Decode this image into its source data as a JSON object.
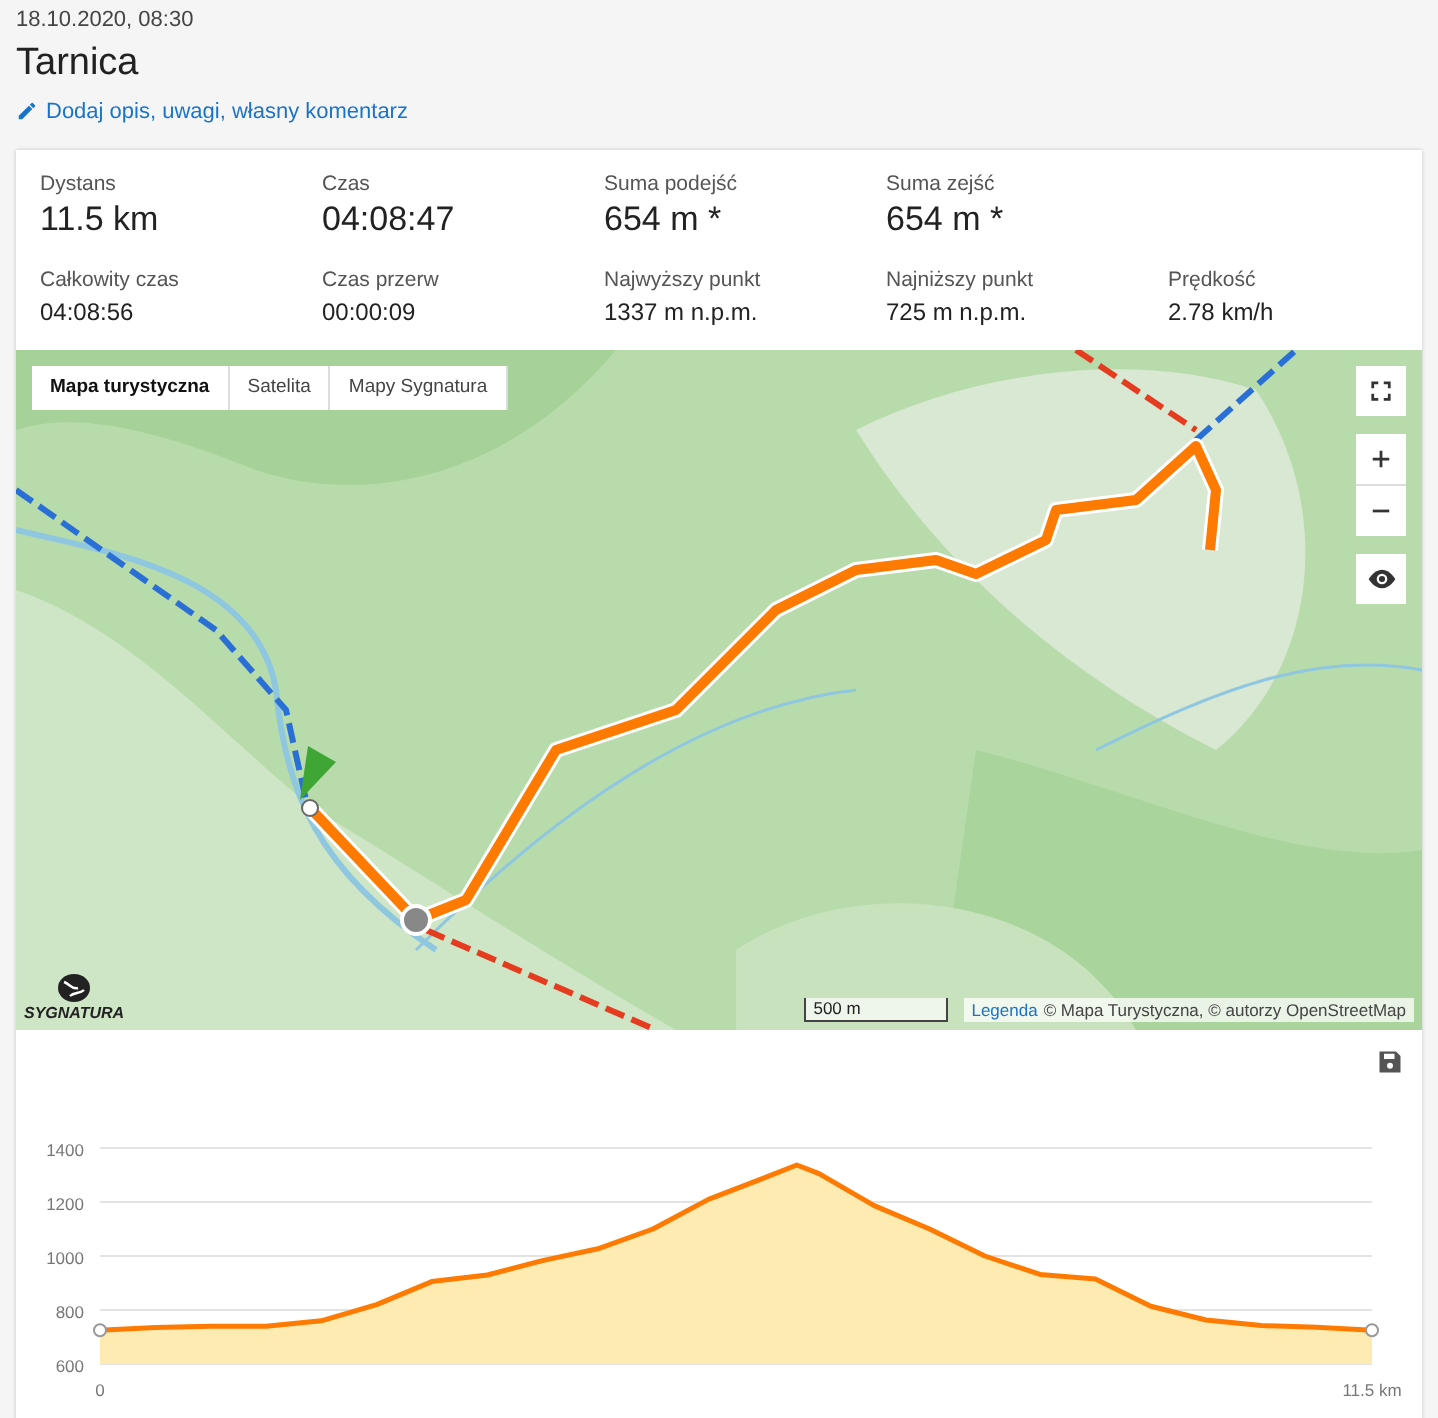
{
  "header": {
    "date": "18.10.2020, 08:30",
    "title": "Tarnica",
    "comment_link": "Dodaj opis, uwagi, własny komentarz"
  },
  "stats": {
    "primary": [
      {
        "label": "Dystans",
        "value": "11.5 km"
      },
      {
        "label": "Czas",
        "value": "04:08:47"
      },
      {
        "label": "Suma podejść",
        "value": "654 m *"
      },
      {
        "label": "Suma zejść",
        "value": "654 m *"
      }
    ],
    "secondary": [
      {
        "label": "Całkowity czas",
        "value": "04:08:56"
      },
      {
        "label": "Czas przerw",
        "value": "00:00:09"
      },
      {
        "label": "Najwyższy punkt",
        "value": "1337 m n.p.m."
      },
      {
        "label": "Najniższy punkt",
        "value": "725 m n.p.m."
      },
      {
        "label": "Prędkość",
        "value": "2.78 km/h"
      }
    ]
  },
  "map": {
    "kind": "picture",
    "layer_tabs": [
      {
        "label": "Mapa turystyczna",
        "selected": true
      },
      {
        "label": "Satelita",
        "selected": false
      },
      {
        "label": "Mapy Sygnatura",
        "selected": false
      }
    ],
    "logo": "SYGNATURA",
    "scale": "500 m",
    "attribution_link": "Legenda",
    "attribution": "© Mapa Turystyczna, © autorzy OpenStreetMap"
  },
  "elevation": {
    "chart_data": {
      "type": "area",
      "x": [
        0,
        0.5,
        1,
        1.5,
        2,
        2.5,
        3,
        3.5,
        4,
        4.5,
        5,
        5.5,
        6,
        6.3,
        6.5,
        7,
        7.5,
        8,
        8.5,
        9,
        9.5,
        10,
        10.5,
        11,
        11.5
      ],
      "series": [
        {
          "color": "#ff7a00",
          "values": [
            725,
            735,
            740,
            740,
            760,
            820,
            905,
            930,
            983,
            1027,
            1100,
            1210,
            1288,
            1337,
            1305,
            1187,
            1100,
            1000,
            932,
            915,
            814,
            763,
            742,
            736,
            725
          ]
        }
      ],
      "xlim": [
        0,
        11.5
      ],
      "ylim": [
        600,
        1400
      ],
      "xticks": [
        0,
        {
          "value": 11.5,
          "label": "11.5 km"
        }
      ],
      "yticks": [
        600,
        800,
        1000,
        1200,
        1400
      ],
      "grid": true
    }
  }
}
